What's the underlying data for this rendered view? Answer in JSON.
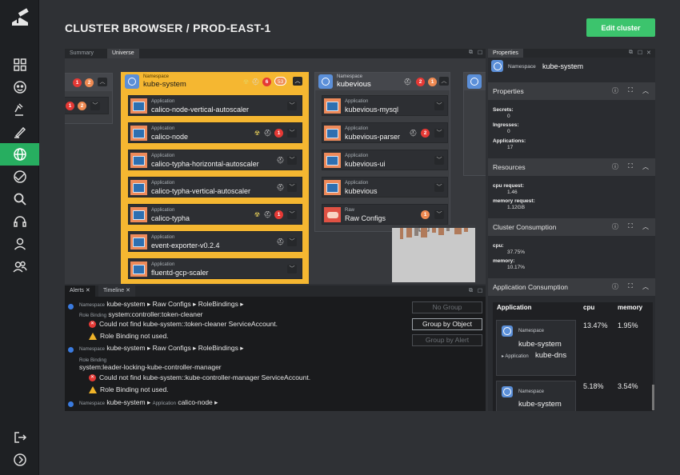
{
  "header": {
    "title": "CLUSTER BROWSER / PROD-EAST-1",
    "edit_button": "Edit cluster"
  },
  "sidebar": {
    "items": [
      "dashboard-icon",
      "face-icon",
      "gavel-icon",
      "brush-icon",
      "universe-icon",
      "rule-icon",
      "search-icon",
      "headset-icon",
      "user-icon",
      "users-icon"
    ],
    "bottom": [
      "logout-icon",
      "expand-icon"
    ],
    "active": "universe-icon"
  },
  "main": {
    "tabs": [
      {
        "label": "Summary"
      },
      {
        "label": "Universe"
      }
    ],
    "partial_ns": {
      "badges": [
        "1",
        "2",
        "1",
        "2"
      ]
    },
    "namespaces": [
      {
        "type": "Namespace",
        "name": "kube-system",
        "highlighted": true,
        "badges": [
          "6",
          "53"
        ],
        "apps": [
          {
            "type": "Application",
            "name": "calico-node-vertical-autoscaler"
          },
          {
            "type": "Application",
            "name": "calico-node",
            "badge": "1"
          },
          {
            "type": "Application",
            "name": "calico-typha-horizontal-autoscaler"
          },
          {
            "type": "Application",
            "name": "calico-typha-vertical-autoscaler"
          },
          {
            "type": "Application",
            "name": "calico-typha",
            "badge": "1"
          },
          {
            "type": "Application",
            "name": "event-exporter-v0.2.4"
          },
          {
            "type": "Application",
            "name": "fluentd-gcp-scaler"
          }
        ]
      },
      {
        "type": "Namespace",
        "name": "kubevious",
        "highlighted": false,
        "badges": [
          "2",
          "1"
        ],
        "apps": [
          {
            "type": "Application",
            "name": "kubevious-mysql"
          },
          {
            "type": "Application",
            "name": "kubevious-parser",
            "badge": "2"
          },
          {
            "type": "Application",
            "name": "kubevious-ui"
          },
          {
            "type": "Application",
            "name": "kubevious"
          },
          {
            "type": "Raw",
            "name": "Raw Configs",
            "badge": "1"
          }
        ]
      }
    ]
  },
  "bottom": {
    "tabs": [
      {
        "label": "Alerts"
      },
      {
        "label": "Timeline"
      }
    ],
    "alerts": [
      {
        "path": {
          "ns_tag": "Namespace",
          "ns": "kube-system",
          "p2": "Raw Configs",
          "p3": "RoleBindings"
        },
        "rb_tag": "Role Binding",
        "rb": "system:controller:token-cleaner",
        "error": "Could not find kube-system::token-cleaner ServiceAccount.",
        "warning": "Role Binding not used."
      },
      {
        "path": {
          "ns_tag": "Namespace",
          "ns": "kube-system",
          "p2": "Raw Configs",
          "p3": "RoleBindings"
        },
        "rb_tag": "Role Binding",
        "rb": "system:leader-locking-kube-controller-manager",
        "error": "Could not find kube-system::kube-controller-manager ServiceAccount.",
        "warning": "Role Binding not used."
      },
      {
        "path": {
          "ns_tag": "Namespace",
          "ns": "kube-system",
          "p2_tag": "Application",
          "p2": "calico-node"
        }
      }
    ],
    "group_buttons": [
      "No Group",
      "Group by Object",
      "Group by Alert"
    ]
  },
  "properties": {
    "tab": "Properties",
    "ns_tag": "Namespace",
    "ns": "kube-system",
    "sections": {
      "properties": {
        "title": "Properties",
        "rows": [
          {
            "k": "Secrets:",
            "v": "0"
          },
          {
            "k": "Ingresses:",
            "v": "0"
          },
          {
            "k": "Applications:",
            "v": "17"
          }
        ]
      },
      "resources": {
        "title": "Resources",
        "rows": [
          {
            "k": "cpu request:",
            "v": "1.46"
          },
          {
            "k": "memory request:",
            "v": "1.12GB"
          }
        ]
      },
      "cluster": {
        "title": "Cluster Consumption",
        "rows": [
          {
            "k": "cpu:",
            "v": "37.75%"
          },
          {
            "k": "memory:",
            "v": "10.17%"
          }
        ]
      },
      "app": {
        "title": "Application Consumption",
        "headers": [
          "Application",
          "cpu",
          "memory"
        ],
        "rows": [
          {
            "ns_tag": "Namespace",
            "ns": "kube-system",
            "app_tag": "Application",
            "app": "kube-dns",
            "cpu": "13.47%",
            "memory": "1.95%"
          },
          {
            "ns_tag": "Namespace",
            "ns": "kube-system",
            "cpu": "5.18%",
            "memory": "3.54%"
          }
        ]
      }
    }
  }
}
